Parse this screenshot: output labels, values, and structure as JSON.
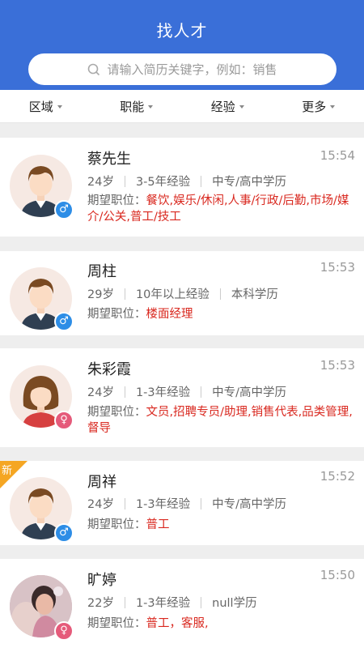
{
  "header": {
    "title": "找人才"
  },
  "search": {
    "placeholder": "请输入简历关键字，例如：销售"
  },
  "filters": [
    {
      "label": "区域"
    },
    {
      "label": "职能"
    },
    {
      "label": "经验"
    },
    {
      "label": "更多"
    }
  ],
  "candidates": [
    {
      "name": "蔡先生",
      "time": "15:54",
      "age": "24岁",
      "experience": "3-5年经验",
      "education": "中专/高中学历",
      "position_label": "期望职位：",
      "positions": "餐饮,娱乐/休闲,人事/行政/后勤,市场/媒介/公关,普工/技工",
      "gender": "male",
      "gender_icon": "male-icon",
      "is_new": false
    },
    {
      "name": "周柱",
      "time": "15:53",
      "age": "29岁",
      "experience": "10年以上经验",
      "education": "本科学历",
      "position_label": "期望职位：",
      "positions": "楼面经理",
      "gender": "male",
      "gender_icon": "male-icon",
      "is_new": false
    },
    {
      "name": "朱彩霞",
      "time": "15:53",
      "age": "24岁",
      "experience": "1-3年经验",
      "education": "中专/高中学历",
      "position_label": "期望职位：",
      "positions": "文员,招聘专员/助理,销售代表,品类管理,督导",
      "gender": "female",
      "gender_icon": "female-icon",
      "is_new": false
    },
    {
      "name": "周祥",
      "time": "15:52",
      "age": "24岁",
      "experience": "1-3年经验",
      "education": "中专/高中学历",
      "position_label": "期望职位：",
      "positions": "普工",
      "gender": "male",
      "gender_icon": "male-icon",
      "is_new": true,
      "new_badge": "新"
    },
    {
      "name": "旷婷",
      "time": "15:50",
      "age": "22岁",
      "experience": "1-3年经验",
      "education": "null学历",
      "position_label": "期望职位：",
      "positions": "普工，客服,",
      "gender": "female",
      "gender_icon": "female-icon",
      "is_new": false
    }
  ],
  "colors": {
    "header": "#3a6fd8",
    "accent_red": "#d9281f",
    "male": "#2d8de6",
    "female": "#e55a7a",
    "new_badge": "#f5a623"
  }
}
